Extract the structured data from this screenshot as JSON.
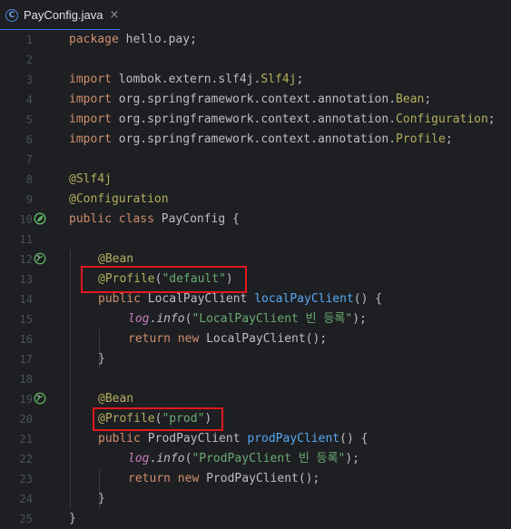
{
  "tab": {
    "icon": "class-c-icon",
    "icon_letter": "C",
    "title": "PayConfig.java",
    "close": "×"
  },
  "line_numbers": [
    "1",
    "2",
    "3",
    "4",
    "5",
    "6",
    "7",
    "8",
    "9",
    "10",
    "11",
    "12",
    "13",
    "14",
    "15",
    "16",
    "17",
    "18",
    "19",
    "20",
    "21",
    "22",
    "23",
    "24",
    "25"
  ],
  "code": {
    "l1": {
      "kw": "package",
      "rest": " hello.pay;"
    },
    "l3": {
      "kw": "import",
      "pkg": " lombok.extern.slf4j.",
      "cls": "Slf4j",
      "end": ";"
    },
    "l4": {
      "kw": "import",
      "pkg": " org.springframework.context.annotation.",
      "cls": "Bean",
      "end": ";"
    },
    "l5": {
      "kw": "import",
      "pkg": " org.springframework.context.annotation.",
      "cls": "Configuration",
      "end": ";"
    },
    "l6": {
      "kw": "import",
      "pkg": " org.springframework.context.annotation.",
      "cls": "Profile",
      "end": ";"
    },
    "l8": {
      "ann": "@Slf4j"
    },
    "l9": {
      "ann": "@Configuration"
    },
    "l10": {
      "kw1": "public",
      "kw2": "class",
      "rest": " PayConfig {"
    },
    "l12": {
      "ann": "@Bean"
    },
    "l13": {
      "ann": "@Profile",
      "open": "(",
      "str": "\"default\"",
      "close": ")"
    },
    "l14": {
      "kw": "public",
      "type": " LocalPayClient ",
      "method": "localPayClient",
      "rest": "() {"
    },
    "l15": {
      "field": "log",
      "dot": ".",
      "call": "info",
      "open": "(",
      "str": "\"LocalPayClient 빈 등록\"",
      "close": ");"
    },
    "l16": {
      "kw1": "return",
      "kw2": "new",
      "rest": " LocalPayClient();"
    },
    "l17": {
      "rest": "}"
    },
    "l19": {
      "ann": "@Bean"
    },
    "l20": {
      "ann": "@Profile",
      "open": "(",
      "str": "\"prod\"",
      "close": ")"
    },
    "l21": {
      "kw": "public",
      "type": " ProdPayClient ",
      "method": "prodPayClient",
      "rest": "() {"
    },
    "l22": {
      "field": "log",
      "dot": ".",
      "call": "info",
      "open": "(",
      "str": "\"ProdPayClient 빈 등록\"",
      "close": ");"
    },
    "l23": {
      "kw1": "return",
      "kw2": "new",
      "rest": " ProdPayClient();"
    },
    "l24": {
      "rest": "}"
    },
    "l25": {
      "rest": "}"
    }
  },
  "gutter_icons": [
    "bean-class-icon",
    "bean-method-icon",
    "bean-method-icon"
  ],
  "colors": {
    "background": "#1e1f22",
    "keyword": "#cf8e6d",
    "annotation": "#b3ae60",
    "string": "#6aab73",
    "method": "#56a8f5",
    "field": "#c77dbb",
    "highlight_box": "#e0191e"
  }
}
